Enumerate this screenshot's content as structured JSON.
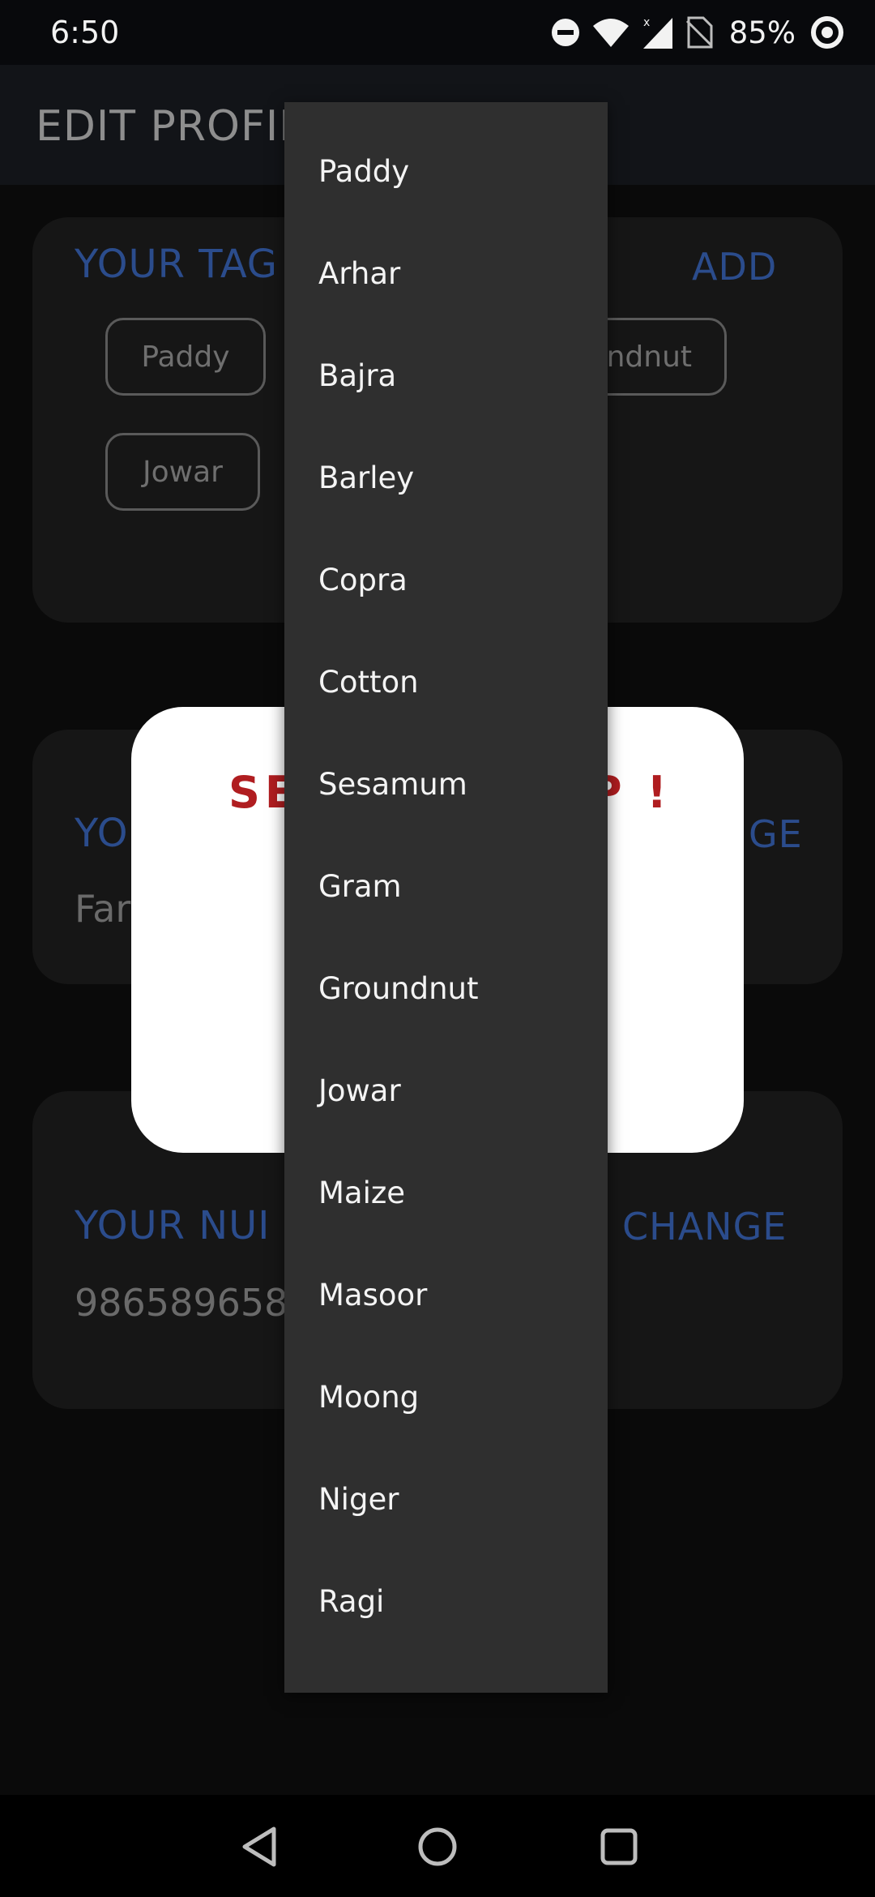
{
  "status_bar": {
    "time": "6:50",
    "battery": "85%",
    "icons": [
      "do-not-disturb-icon",
      "wifi-icon",
      "cell-signal-icon",
      "no-sim-icon",
      "battery-ring-icon"
    ]
  },
  "app_bar": {
    "title": "EDIT PROFIL"
  },
  "tags_card": {
    "heading": "YOUR TAG",
    "action": "ADD",
    "chips": [
      "Paddy",
      "ndnut",
      "Jowar"
    ]
  },
  "type_card": {
    "heading": "YO",
    "action": "GE",
    "value": "Far"
  },
  "number_card": {
    "heading": "YOUR NUI",
    "action": "CHANGE",
    "value": "986589658"
  },
  "modal": {
    "title_left": "SE",
    "title_right": "P !"
  },
  "dropdown": {
    "items": [
      "Paddy",
      "Arhar",
      "Bajra",
      "Barley",
      "Copra",
      "Cotton",
      "Sesamum",
      "Gram",
      "Groundnut",
      "Jowar",
      "Maize",
      "Masoor",
      "Moong",
      "Niger",
      "Ragi"
    ]
  },
  "nav_bar": {
    "icons": [
      "back-icon",
      "home-icon",
      "recents-icon"
    ]
  },
  "colors": {
    "accent_blue": "#2b4c8c",
    "alert_red": "#b01d20",
    "menu_bg": "#2f2f2f"
  }
}
